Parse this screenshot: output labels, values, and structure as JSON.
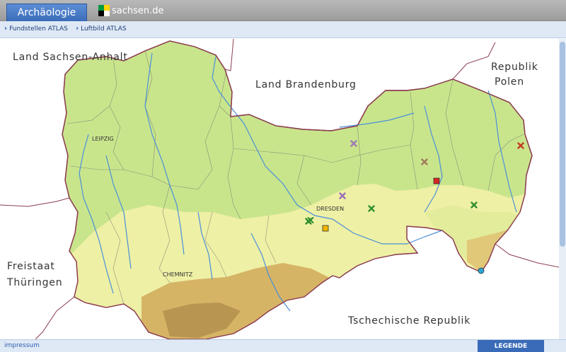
{
  "header": {
    "app_tab": "Archäologie",
    "logo_text": "sachsen.de",
    "logo_colors": [
      "#009a3e",
      "#ffd400",
      "#000000",
      "#ffffff"
    ]
  },
  "nav": {
    "links": [
      {
        "label": "Fundstellen ATLAS"
      },
      {
        "label": "Luftbild ATLAS"
      }
    ]
  },
  "map": {
    "neighbors": [
      {
        "label": "Land Sachsen-Anhalt"
      },
      {
        "label": "Land Brandenburg"
      },
      {
        "label": "Republik"
      },
      {
        "label": "Polen"
      },
      {
        "label": "Freistaat"
      },
      {
        "label": "Thüringen"
      },
      {
        "label": "Tschechische Republik"
      }
    ],
    "cities": [
      {
        "label": "LEIPZIG"
      },
      {
        "label": "DRESDEN"
      },
      {
        "label": "CHEMNITZ"
      }
    ],
    "markers": [
      {
        "type": "cross",
        "color": "#a07ab8"
      },
      {
        "type": "cross",
        "color": "#a47a5c"
      },
      {
        "type": "cross",
        "color": "#c23b22"
      },
      {
        "type": "square",
        "color": "#d8231f"
      },
      {
        "type": "cross",
        "color": "#9b6fb8"
      },
      {
        "type": "cross",
        "color": "#2f8f2f"
      },
      {
        "type": "cross",
        "color": "#2f8f2f"
      },
      {
        "type": "cross",
        "color": "#2f8f2f"
      },
      {
        "type": "square",
        "color": "#f0b400"
      },
      {
        "type": "circle",
        "color": "#2aa7d6"
      }
    ],
    "colors": {
      "lowland": "#c9e58c",
      "hills": "#eef0a5",
      "mountains": "#d6b466",
      "high_mountains": "#b89550",
      "rivers": "#4a8fd9",
      "border": "#8b3d4f"
    }
  },
  "footer": {
    "impressum": "impressum",
    "legend_button": "LEGENDE"
  }
}
